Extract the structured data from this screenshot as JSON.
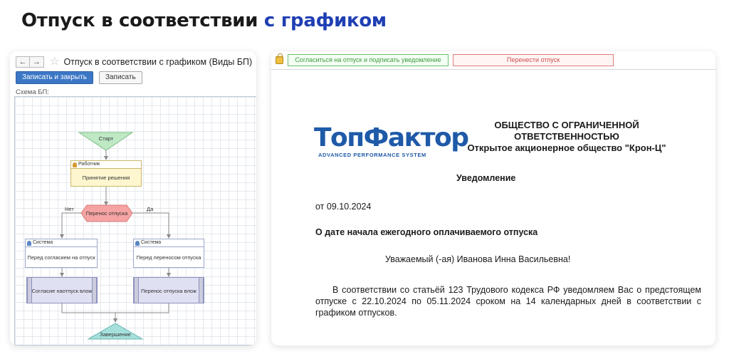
{
  "headline": {
    "part1": "Отпуск в соответствии ",
    "part2": "с графиком",
    "accent_color": "#1f3fb3"
  },
  "left_window": {
    "back_icon": "←",
    "forward_icon": "→",
    "star_icon": "☆",
    "title": "Отпуск в соответствии с графиком (Виды БП)",
    "save_close_label": "Записать и закрыть",
    "save_label": "Записать",
    "schema_label": "Схема БП:",
    "flow": {
      "start": "Старт",
      "worker_lane": "Работник",
      "worker_task": "Принятие решения",
      "decision": "Перенос отпуска",
      "no_label": "Нет",
      "yes_label": "Да",
      "system_left": "Система",
      "system_left_task": "Перед согласием на отпуск",
      "system_right": "Система",
      "system_right_task": "Перед переносом отпуска",
      "proc_left": "Согласие наотпуск влож",
      "proc_right": "Перенос отпуска влож",
      "end": "Завершение"
    }
  },
  "right_doc": {
    "agree_button": "Согласиться на отпуск и подписать уведомление",
    "move_button": "Перенести отпуск",
    "logo_main": "ТопФактор",
    "logo_sub": "ADVANCED PERFORMANCE SYSTEM",
    "org_line1": "ОБЩЕСТВО С ОГРАНИЧЕННОЙ",
    "org_line2": "ОТВЕТСТВЕННОСТЬЮ",
    "org_line3": "Открытое акционерное общество \"Крон-Ц\"",
    "title": "Уведомление",
    "date": "от 09.10.2024",
    "subject": "О дате начала ежегодного оплачиваемого отпуска",
    "greeting": "Уважаемый (-ая) Иванова Инна Васильевна!",
    "body": "В соответствии со статьёй 123 Трудового кодекса РФ уведомляем Вас о предстоящем отпуске с 22.10.2024 по 05.11.2024 сроком на 14 календарных дней в соответствии с графиком отпусков."
  }
}
